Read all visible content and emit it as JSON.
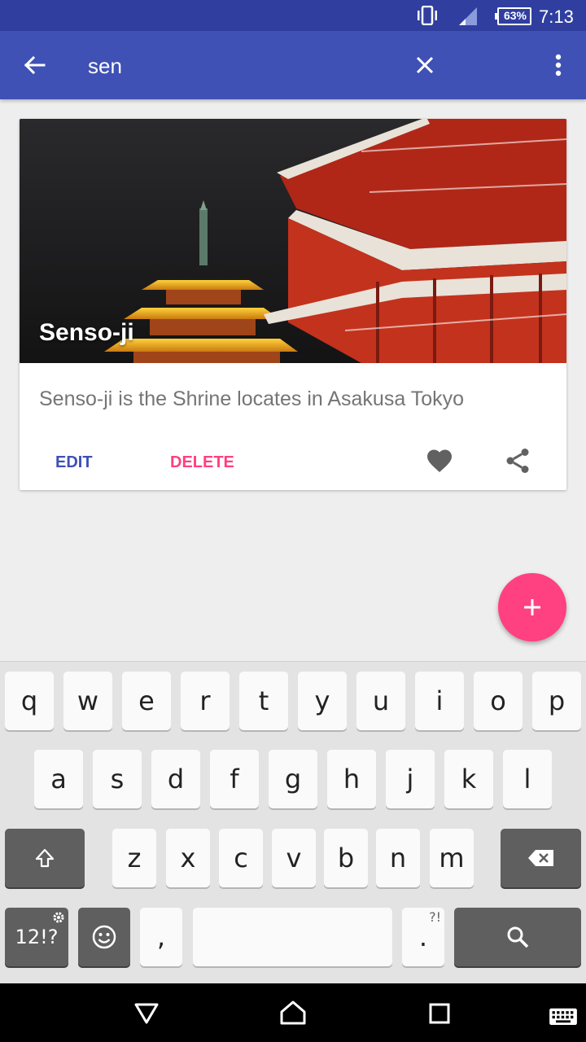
{
  "status_bar": {
    "battery": "63%",
    "time": "7:13"
  },
  "app_bar": {
    "search_query": "sen"
  },
  "card": {
    "title": "Senso-ji",
    "description": "Senso-ji is the Shrine locates in Asakusa Tokyo",
    "edit_label": "EDIT",
    "delete_label": "DELETE",
    "image": "pagoda-temple-photo"
  },
  "keyboard": {
    "row1": [
      "q",
      "w",
      "e",
      "r",
      "t",
      "y",
      "u",
      "i",
      "o",
      "p"
    ],
    "row2": [
      "a",
      "s",
      "d",
      "f",
      "g",
      "h",
      "j",
      "k",
      "l"
    ],
    "row3": [
      "z",
      "x",
      "c",
      "v",
      "b",
      "n",
      "m"
    ],
    "symbols_label": "12!?",
    "comma": ",",
    "period": ".",
    "period_hint": "?!"
  },
  "colors": {
    "primary": "#3f51b5",
    "primary_dark": "#303f9f",
    "accent": "#ff4081"
  }
}
